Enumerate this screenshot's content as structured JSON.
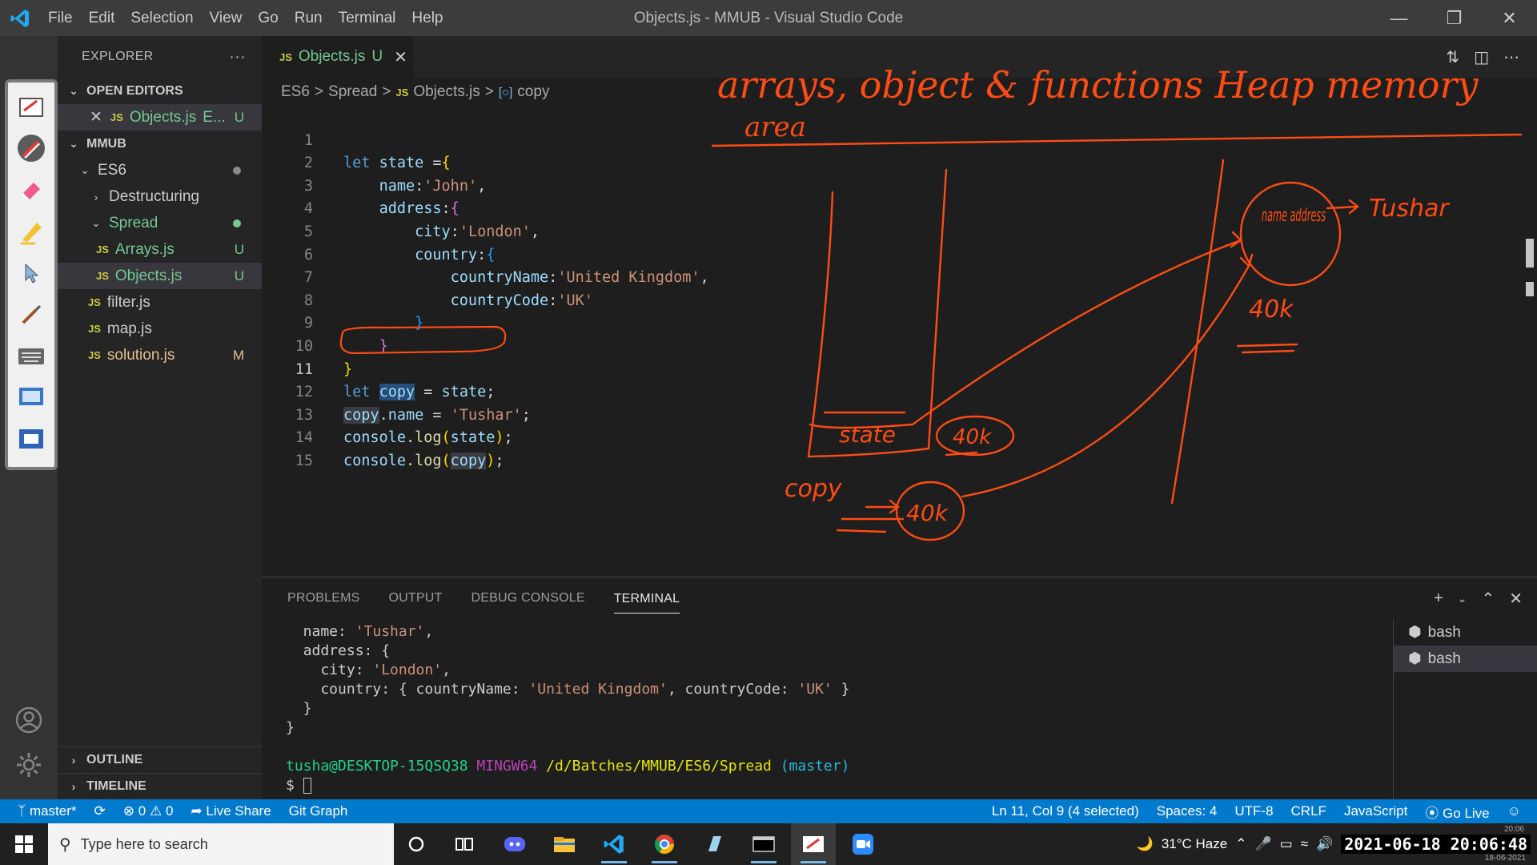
{
  "window": {
    "title": "Objects.js - MMUB - Visual Studio Code",
    "menu": [
      "File",
      "Edit",
      "Selection",
      "View",
      "Go",
      "Run",
      "Terminal",
      "Help"
    ]
  },
  "sidebar": {
    "title": "EXPLORER",
    "more": "···",
    "open_editors_label": "OPEN EDITORS",
    "open_editor_item": {
      "name": "Objects.js",
      "suffix": "E...",
      "badge": "U"
    },
    "workspace_label": "MMUB",
    "tree": [
      {
        "label": "ES6",
        "badge": ""
      },
      {
        "label": "Destructuring",
        "badge": ""
      },
      {
        "label": "Spread",
        "badge": ""
      },
      {
        "label": "Arrays.js",
        "badge": "U"
      },
      {
        "label": "Objects.js",
        "badge": "U"
      },
      {
        "label": "filter.js",
        "badge": ""
      },
      {
        "label": "map.js",
        "badge": ""
      },
      {
        "label": "solution.js",
        "badge": "M"
      }
    ],
    "outline_label": "OUTLINE",
    "timeline_label": "TIMELINE",
    "js_tag": "JS"
  },
  "tab": {
    "name": "Objects.js",
    "badge": "U",
    "close": "✕"
  },
  "breadcrumb": {
    "folder1": "ES6",
    "folder2": "Spread",
    "file": "Objects.js",
    "symbol": "copy",
    "sep": ">"
  },
  "code": {
    "line_numbers": [
      "1",
      "2",
      "3",
      "4",
      "5",
      "6",
      "7",
      "8",
      "9",
      "10",
      "11",
      "12",
      "13",
      "14",
      "15"
    ],
    "l1": {
      "kw": "let",
      "var": "state",
      "rest": " =",
      "br": "{"
    },
    "l2": {
      "key": "name",
      "str": "'John'"
    },
    "l3": {
      "key": "address",
      "br": "{"
    },
    "l4": {
      "key": "city",
      "str": "'London'"
    },
    "l5": {
      "key": "country",
      "br": "{"
    },
    "l6": {
      "key": "countryName",
      "str": "'United Kingdom'"
    },
    "l7": {
      "key": "countryCode",
      "str": "'UK'"
    },
    "l8": "}",
    "l9": "}",
    "l10": "}",
    "l11": {
      "kw": "let",
      "var": "copy",
      "rest": " = ",
      "var2": "state",
      "end": ";"
    },
    "l12": {
      "var": "copy",
      "prop": ".name",
      "rest": " = ",
      "str": "'Tushar'",
      "end": ";"
    },
    "l13": {
      "obj": "console",
      "fn": ".log",
      "arg": "state"
    },
    "l14": {
      "obj": "console",
      "fn": ".log",
      "arg": "copy"
    }
  },
  "ink": {
    "heading": "arrays, object & functions Heap memory",
    "heading2": "area",
    "state_label": "state",
    "copy_label": "copy",
    "addr1": "40k",
    "addr2": "40k",
    "heap_addr": "40k",
    "heap_obj": "name address",
    "heap_value": "Tushar"
  },
  "panel": {
    "tabs": [
      "PROBLEMS",
      "OUTPUT",
      "DEBUG CONSOLE",
      "TERMINAL"
    ],
    "terminals": [
      "bash",
      "bash"
    ],
    "output": {
      "l1_key": "  name: ",
      "l1_val": "'Tushar'",
      "l1_end": ",",
      "l2": "  address: {",
      "l3_key": "    city: ",
      "l3_val": "'London'",
      "l3_end": ",",
      "l4_a": "    country: { countryName: ",
      "l4_b": "'United Kingdom'",
      "l4_c": ", countryCode: ",
      "l4_d": "'UK'",
      "l4_e": " }",
      "l5": "  }",
      "l6": "}",
      "prompt_user": "tusha@DESKTOP-15QSQ38",
      "prompt_env": "MINGW64",
      "prompt_path": "/d/Batches/MMUB/ES6/Spread",
      "prompt_branch": "(master)",
      "prompt_symbol": "$"
    }
  },
  "statusbar": {
    "branch": "master*",
    "errors": "0",
    "warnings": "0",
    "liveshare": "Live Share",
    "gitgraph": "Git Graph",
    "position": "Ln 11, Col 9 (4 selected)",
    "spaces": "Spaces: 4",
    "encoding": "UTF-8",
    "eol": "CRLF",
    "language": "JavaScript",
    "golive": "Go Live"
  },
  "taskbar": {
    "search_placeholder": "Type here to search",
    "weather": "31°C Haze",
    "clock": "2021-06-18 20:06:48",
    "clock_small_time": "20:06",
    "clock_small_date": "18-06-2021"
  },
  "colors": {
    "accent": "#007acc",
    "ink": "#ff4c14",
    "untracked": "#73c991",
    "modified": "#e2c08d"
  }
}
